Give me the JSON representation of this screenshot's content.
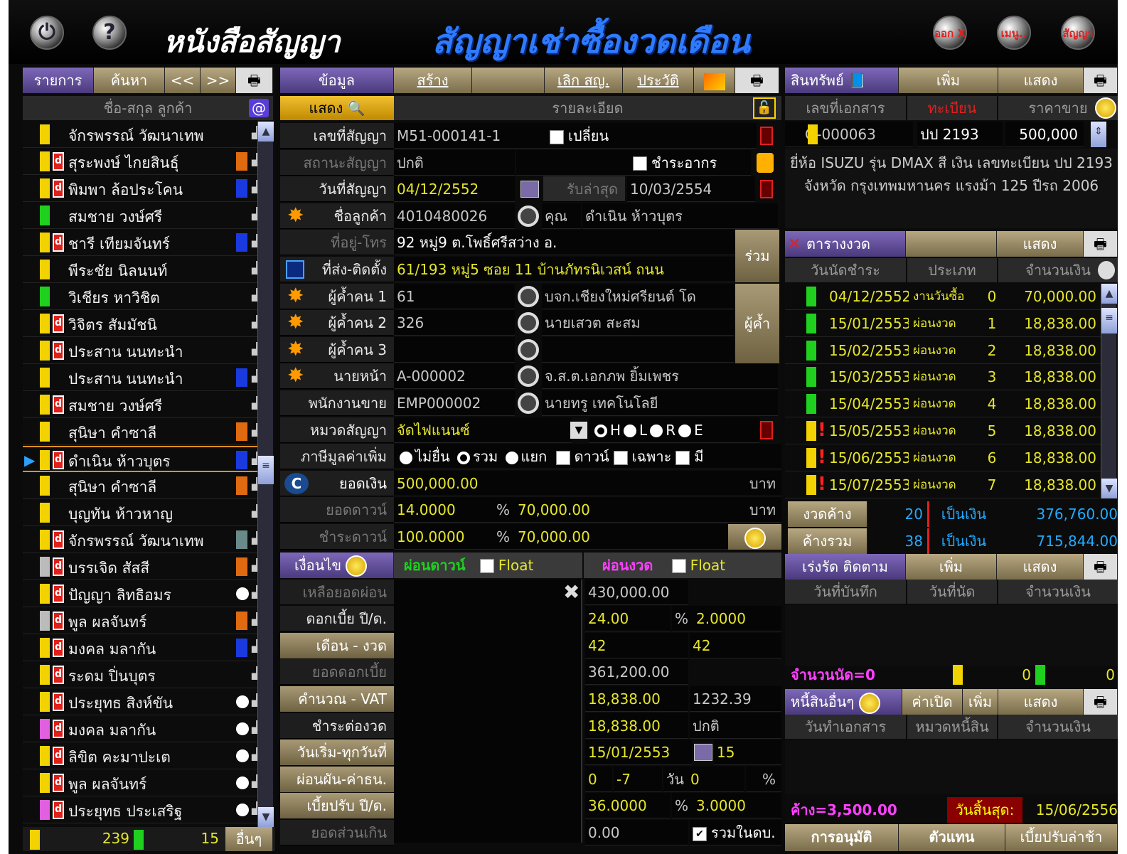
{
  "header": {
    "title": "หนังสือสัญญา",
    "subtitle": "สัญญาเช่าซื้องวดเดือน",
    "right_buttons": [
      "ออก X",
      "เมนู..",
      "สัญญา"
    ],
    "left_icons": [
      "power-icon",
      "help-icon"
    ]
  },
  "left_panel": {
    "toolbar": {
      "list": "รายการ",
      "search": "ค้นหา",
      "prev": "<<",
      "next": ">>"
    },
    "column_header": "ชื่อ-สกุล ลูกค้า",
    "customers": [
      {
        "name": "จักรพรรณ์ วัฒนาเทพ",
        "bar": "yellow",
        "badge": false,
        "swatch": ""
      },
      {
        "name": "สุระพงษ์ ไกยสินธุ์",
        "bar": "yellow",
        "badge": true,
        "swatch": "#e06a10"
      },
      {
        "name": "พิมพา ล้อประโคน",
        "bar": "yellow",
        "badge": true,
        "swatch": "#1a3ae0"
      },
      {
        "name": "สมชาย วงษ์ศรี",
        "bar": "green",
        "badge": false,
        "swatch": ""
      },
      {
        "name": "ชารี เทียมจันทร์",
        "bar": "yellow",
        "badge": true,
        "swatch": "#1a3ae0"
      },
      {
        "name": "พีระชัย นิลนนท์",
        "bar": "yellow",
        "badge": false,
        "swatch": ""
      },
      {
        "name": "วิเชียร หาวิชิต",
        "bar": "green",
        "badge": false,
        "swatch": ""
      },
      {
        "name": "วิจิตร สัมมัชนิ",
        "bar": "yellow",
        "badge": true,
        "swatch": ""
      },
      {
        "name": "ประสาน นนทะนำ",
        "bar": "yellow",
        "badge": true,
        "swatch": ""
      },
      {
        "name": "ประสาน นนทะนำ",
        "bar": "yellow",
        "badge": false,
        "swatch": "#1a3ae0"
      },
      {
        "name": "สมชาย วงษ์ศรี",
        "bar": "yellow",
        "badge": true,
        "swatch": ""
      },
      {
        "name": "สุนิษา คำซาลี",
        "bar": "yellow",
        "badge": false,
        "swatch": "#e06a10"
      },
      {
        "name": "ดำเนิน ห้าวบุตร",
        "bar": "yellow",
        "badge": true,
        "swatch": "#1a3ae0"
      },
      {
        "name": "สุนิษา คำซาลี",
        "bar": "yellow",
        "badge": false,
        "swatch": "#e06a10"
      },
      {
        "name": "บุญทัน ห้าวหาญ",
        "bar": "yellow",
        "badge": false,
        "swatch": ""
      },
      {
        "name": "จักรพรรณ์ วัฒนาเทพ",
        "bar": "yellow",
        "badge": true,
        "swatch": "#6a8a8a"
      },
      {
        "name": "บรรเจิด สัสสี",
        "bar": "silver",
        "badge": true,
        "swatch": "#e06a10"
      },
      {
        "name": "ปัญญา ลิทธิอมร",
        "bar": "yellow",
        "badge": true,
        "swatch": "#ffffff"
      },
      {
        "name": "พูล ผลจันทร์",
        "bar": "silver",
        "badge": true,
        "swatch": "#e06a10"
      },
      {
        "name": "มงคล มลากัน",
        "bar": "yellow",
        "badge": true,
        "swatch": "#1a3ae0"
      },
      {
        "name": "ระดม ปิ่นบุตร",
        "bar": "yellow",
        "badge": true,
        "swatch": ""
      },
      {
        "name": "ประยุทธ สิงห์ขัน",
        "bar": "yellow",
        "badge": true,
        "swatch": "#ffffff"
      },
      {
        "name": "มงคล มลากัน",
        "bar": "pink",
        "badge": true,
        "swatch": "#ffffff"
      },
      {
        "name": "ลิขิต คะมาปะเต",
        "bar": "yellow",
        "badge": true,
        "swatch": "#ffffff"
      },
      {
        "name": "พูล ผลจันทร์",
        "bar": "yellow",
        "badge": true,
        "swatch": "#ffffff"
      },
      {
        "name": "ประยุทธ ประเสริฐ",
        "bar": "pink",
        "badge": true,
        "swatch": "#ffffff"
      }
    ],
    "footer": {
      "count1": "239",
      "count2": "15",
      "other": "อื่นๆ"
    }
  },
  "middle": {
    "toolbar": {
      "info": "ข้อมูล",
      "create": "สร้าง",
      "cancel": "เลิก สญ.",
      "history": "ประวัติ"
    },
    "show_label": "แสดง",
    "detail_label": "รายละเอียด",
    "fields": {
      "contract_no_label": "เลขที่สัญญา",
      "contract_no": "M51-000141-1",
      "change_label": "เปลี่ยน",
      "status_label": "สถานะสัญญา",
      "status": "ปกติ",
      "stamp_label": "ชำระอากร",
      "date_label": "วันที่สัญญา",
      "date": "04/12/2552",
      "last_recv_label": "รับล่าสุด",
      "last_recv": "10/03/2554",
      "customer_label": "ชื่อลูกค้า",
      "customer_code": "4010480026",
      "customer_name": "คุณ",
      "customer_name2": "ดำเนิน ห้าวบุตร",
      "address_label": "ที่อยู่-โทร",
      "address": "92 หมู่9 ต.โพธิ์ศรีสว่าง อ.",
      "install_label": "ที่ส่ง-ติดตั้ง",
      "install": "61/193 หมู่5 ซอย 11 บ้านภัทรนิเวสน์ ถนน",
      "joint_btn": "ร่วม",
      "g1_label": "ผู้ค้ำคน 1",
      "g1_code": "61",
      "g1_name": "บจก.เชียงใหม่ศรียนต์ โด",
      "g2_label": "ผู้ค้ำคน 2",
      "g2_code": "326",
      "g2_name": "นายเสวต สะสม",
      "g3_label": "ผู้ค้ำคน 3",
      "guarantor_btn": "ผู้ค้ำ",
      "broker_label": "นายหน้า",
      "broker_code": "A-000002",
      "broker_name": "จ.ส.ต.เอกภพ ยิ้มเพชร",
      "sales_label": "พนักงานขาย",
      "sales_code": "EMP000002",
      "sales_name": "นายทรู เทคโนโลยี",
      "category_label": "หมวดสัญญา",
      "category": "จัดไฟแนนซ์",
      "grades": [
        "H",
        "L",
        "R",
        "E"
      ],
      "vat_label": "ภาษีมูลค่าเพิ่ม",
      "vat_opts": [
        "ไม่ยื่น",
        "รวม",
        "แยก"
      ],
      "vat_checks": [
        "ดาวน์",
        "เฉพาะ",
        "มี"
      ],
      "amount_label": "ยอดเงิน",
      "amount": "500,000.00",
      "baht": "บาท",
      "down_label": "ยอดดาวน์",
      "down_pct": "14.0000",
      "down_amt": "70,000.00",
      "paydown_label": "ชำระดาวน์",
      "paydown_pct": "100.0000",
      "paydown_amt": "70,000.00"
    },
    "conditions": {
      "title": "เงื่อนไข",
      "down_tab": "ผ่อนดาวน์",
      "install_tab": "ผ่อนงวด",
      "float": "Float",
      "rows": [
        {
          "label": "เหลือยอดผ่อน",
          "v1": "430,000.00",
          "v2": "",
          "dim": true
        },
        {
          "label": "ดอกเบี้ย ปี/ด.",
          "v1": "24.00",
          "v2": "2.0000",
          "pct": true
        },
        {
          "label": "เดือน - งวด",
          "v1": "42",
          "v2": "42",
          "btn": true
        },
        {
          "label": "ยอดดอกเบี้ย",
          "v1": "361,200.00",
          "v2": "",
          "dim": true
        },
        {
          "label": "คำนวณ - VAT",
          "v1": "18,838.00",
          "v2": "1232.39",
          "btn": true
        },
        {
          "label": "ชำระต่องวด",
          "v1": "18,838.00",
          "v2": "ปกติ"
        },
        {
          "label": "วันเริ่ม-ทุกวันที่",
          "v1": "15/01/2553",
          "v2": "15",
          "btn": true
        },
        {
          "label": "ผ่อนผัน-ค่าธน.",
          "v1": "0",
          "v2": "0",
          "btn": true
        },
        {
          "label": "เบี้ยปรับ ปี/ด.",
          "v1": "36.0000",
          "v2": "3.0000",
          "btn": true,
          "pct": true
        },
        {
          "label": "ยอดส่วนเกิน",
          "v1": "0.00",
          "v2": "",
          "dim": true
        }
      ],
      "grace_mid": "-7",
      "day": "วัน",
      "pct_sign": "%",
      "include_label": "รวมในดบ."
    }
  },
  "right": {
    "asset": {
      "title": "สินทรัพย์",
      "add": "เพิ่ม",
      "show": "แสดง",
      "cols": [
        "เลขที่เอกสาร",
        "ทะเบียน",
        "ราคาขาย"
      ],
      "doc": "O-000063",
      "reg": "ปป 2193",
      "price": "500,000",
      "desc": "ยี่ห้อ ISUZU รุ่น DMAX สี เงิน เลขทะเบียน ปป 2193 จังหวัด กรุงเทพมหานคร แรงม้า 125 ปีรถ 2006"
    },
    "schedule": {
      "title": "ตารางงวด",
      "show": "แสดง",
      "cols": [
        "วันนัดชำระ",
        "ประเภท",
        "จำนวนเงิน"
      ],
      "rows": [
        {
          "date": "04/12/2552",
          "type": "งานวันซื้อ",
          "no": "0",
          "amt": "70,000.00",
          "flag": false
        },
        {
          "date": "15/01/2553",
          "type": "ผ่อนงวด",
          "no": "1",
          "amt": "18,838.00",
          "flag": false
        },
        {
          "date": "15/02/2553",
          "type": "ผ่อนงวด",
          "no": "2",
          "amt": "18,838.00",
          "flag": false
        },
        {
          "date": "15/03/2553",
          "type": "ผ่อนงวด",
          "no": "3",
          "amt": "18,838.00",
          "flag": false
        },
        {
          "date": "15/04/2553",
          "type": "ผ่อนงวด",
          "no": "4",
          "amt": "18,838.00",
          "flag": false
        },
        {
          "date": "15/05/2553",
          "type": "ผ่อนงวด",
          "no": "5",
          "amt": "18,838.00",
          "flag": true
        },
        {
          "date": "15/06/2553",
          "type": "ผ่อนงวด",
          "no": "6",
          "amt": "18,838.00",
          "flag": true
        },
        {
          "date": "15/07/2553",
          "type": "ผ่อนงวด",
          "no": "7",
          "amt": "18,838.00",
          "flag": true
        }
      ],
      "overdue_label": "งวดค้าง",
      "overdue_n": "20",
      "as_money": "เป็นเงิน",
      "overdue_amt": "376,760.00",
      "total_label": "ค้างรวม",
      "total_n": "38",
      "total_amt": "715,844.00"
    },
    "followup": {
      "title": "เร่งรัด ติดตาม",
      "add": "เพิ่ม",
      "show": "แสดง",
      "cols": [
        "วันที่บันทึก",
        "วันที่นัด",
        "จำนวนเงิน"
      ],
      "appt": "จำนวนนัด=0",
      "c1": "0",
      "c2": "0"
    },
    "debts": {
      "title": "หนี้สินอื่นๆ",
      "open": "ค่าเปิด",
      "add": "เพิ่ม",
      "show": "แสดง",
      "cols": [
        "วันทำเอกสาร",
        "หมวดหนี้สิน",
        "จำนวนเงิน"
      ],
      "owe": "ค้าง=3,500.00",
      "end_label": "วันสิ้นสุด:",
      "end_date": "15/06/2556"
    },
    "bottom": {
      "approve": "การอนุมัติ",
      "agent": "ตัวแทน",
      "penalty": "เบี้ยปรับล่าช้า"
    }
  },
  "colors": {
    "accent_purple": "#5a4690",
    "gold": "#9b8c64",
    "title_blue": "#2f7bff",
    "red": "#e02020"
  }
}
